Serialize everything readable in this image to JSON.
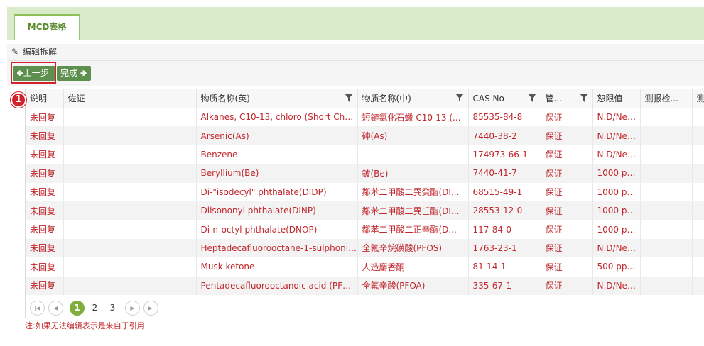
{
  "tab": {
    "label": "MCD表格"
  },
  "panel": {
    "title": "编辑拆解"
  },
  "toolbar": {
    "prev_label": "上一步",
    "done_label": "完成"
  },
  "annotation": {
    "step": "1"
  },
  "table": {
    "columns": [
      "说明",
      "佐证",
      "物质名称(英)",
      "物质名称(中)",
      "CAS No",
      "管...",
      "恕限值",
      "测报检...",
      "测"
    ],
    "rows": [
      [
        "未回复",
        "",
        "Alkanes, C10-13, chloro (Short Chain...",
        "短鏈氯化石蠟 C10-13 (...",
        "85535-84-8",
        "保证",
        "N.D/Neg...",
        "",
        ""
      ],
      [
        "未回复",
        "",
        "Arsenic(As)",
        "砷(As)",
        "7440-38-2",
        "保证",
        "N.D/Neg...",
        "",
        ""
      ],
      [
        "未回复",
        "",
        "Benzene",
        "",
        "174973-66-1",
        "保证",
        "N.D/Neg...",
        "",
        ""
      ],
      [
        "未回复",
        "",
        "Beryllium(Be)",
        "鈹(Be)",
        "7440-41-7",
        "保证",
        "1000 pp...",
        "",
        ""
      ],
      [
        "未回复",
        "",
        "Di-\"isodecyl\" phthalate(DIDP)",
        "鄰苯二甲酸二異癸酯(DI...",
        "68515-49-1",
        "保证",
        "1000 pp...",
        "",
        ""
      ],
      [
        "未回复",
        "",
        "Diisononyl phthalate(DINP)",
        "鄰苯二甲酸二異壬酯(DI...",
        "28553-12-0",
        "保证",
        "1000 pp...",
        "",
        ""
      ],
      [
        "未回复",
        "",
        "Di-n-octyl phthalate(DNOP)",
        "鄰苯二甲酸二正辛酯(D...",
        "117-84-0",
        "保证",
        "1000 pp...",
        "",
        ""
      ],
      [
        "未回复",
        "",
        "Heptadecafluorooctane-1-sulphonic a...",
        "全氟辛烷磺酸(PFOS)",
        "1763-23-1",
        "保证",
        "N.D/Neg...",
        "",
        ""
      ],
      [
        "未回复",
        "",
        "Musk ketone",
        "人造麝香酮",
        "81-14-1",
        "保证",
        "500 pp...",
        "",
        ""
      ],
      [
        "未回复",
        "",
        "Pentadecafluorooctanoic acid (PFOA)",
        "全氟辛酸(PFOA)",
        "335-67-1",
        "保证",
        "N.D/Neg...",
        "",
        ""
      ]
    ]
  },
  "pager": {
    "pages": [
      "1",
      "2",
      "3"
    ],
    "current": "1"
  },
  "footer_note": "注:如果无法编辑表示是来自于引用",
  "colors": {
    "accent": "#7fae3b",
    "button": "#5d8f4e",
    "text_red": "#c1272d",
    "highlight": "#d2232a"
  }
}
